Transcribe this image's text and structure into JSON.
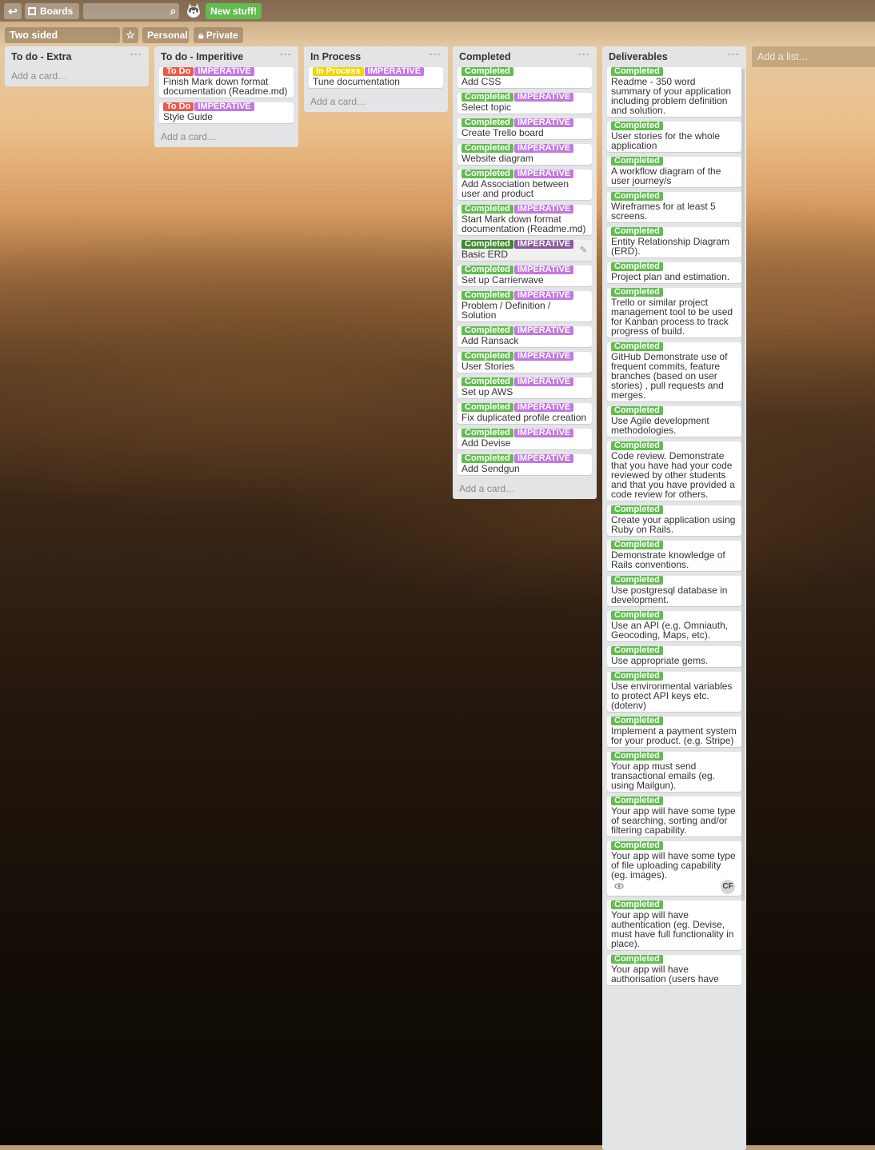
{
  "topbar": {
    "boards_label": "Boards",
    "search_value": "",
    "new_stuff_label": "New stuff!"
  },
  "board": {
    "title": "Two sided marketplace",
    "team_label": "Personal",
    "visibility_label": "Private"
  },
  "colors": {
    "green": "#61bd4f",
    "red": "#eb5a46",
    "purple": "#c377e0",
    "yellow": "#f2d600"
  },
  "add_card_label": "Add a card…",
  "add_list_label": "Add a list…",
  "lists": [
    {
      "name": "To do - Extra",
      "cards": []
    },
    {
      "name": "To do - Imperitive",
      "cards": [
        {
          "labels": [
            "To Do",
            "IMPERATIVE"
          ],
          "title": "Finish Mark down format documentation (Readme.md)"
        },
        {
          "labels": [
            "To Do",
            "IMPERATIVE"
          ],
          "title": "Style Guide"
        }
      ]
    },
    {
      "name": "In Process",
      "cards": [
        {
          "labels": [
            "In Process",
            "IMPERATIVE"
          ],
          "title": "Tune documentation"
        }
      ]
    },
    {
      "name": "Completed",
      "cards": [
        {
          "labels": [
            "Completed"
          ],
          "title": "Add CSS"
        },
        {
          "labels": [
            "Completed",
            "IMPERATIVE"
          ],
          "title": "Select topic"
        },
        {
          "labels": [
            "Completed",
            "IMPERATIVE"
          ],
          "title": "Create Trello board"
        },
        {
          "labels": [
            "Completed",
            "IMPERATIVE"
          ],
          "title": "Website diagram"
        },
        {
          "labels": [
            "Completed",
            "IMPERATIVE"
          ],
          "title": "Add Association between user and product"
        },
        {
          "labels": [
            "Completed",
            "IMPERATIVE"
          ],
          "title": "Start Mark down format documentation (Readme.md)"
        },
        {
          "labels": [
            "Completed",
            "IMPERATIVE"
          ],
          "title": "Basic ERD",
          "hover": true
        },
        {
          "labels": [
            "Completed",
            "IMPERATIVE"
          ],
          "title": "Set up Carrierwave"
        },
        {
          "labels": [
            "Completed",
            "IMPERATIVE"
          ],
          "title": "Problem / Definition / Solution"
        },
        {
          "labels": [
            "Completed",
            "IMPERATIVE"
          ],
          "title": "Add Ransack"
        },
        {
          "labels": [
            "Completed",
            "IMPERATIVE"
          ],
          "title": "User Stories"
        },
        {
          "labels": [
            "Completed",
            "IMPERATIVE"
          ],
          "title": "Set up AWS"
        },
        {
          "labels": [
            "Completed",
            "IMPERATIVE"
          ],
          "title": "Fix duplicated profile creation"
        },
        {
          "labels": [
            "Completed",
            "IMPERATIVE"
          ],
          "title": "Add Devise"
        },
        {
          "labels": [
            "Completed",
            "IMPERATIVE"
          ],
          "title": "Add Sendgun"
        }
      ]
    },
    {
      "name": "Deliverables",
      "cards": [
        {
          "labels": [
            "Completed"
          ],
          "title": "Readme - 350 word summary of your application including problem definition and solution."
        },
        {
          "labels": [
            "Completed"
          ],
          "title": "User stories for the whole application"
        },
        {
          "labels": [
            "Completed"
          ],
          "title": "A workflow diagram of the user journey/s"
        },
        {
          "labels": [
            "Completed"
          ],
          "title": "Wireframes for at least 5 screens."
        },
        {
          "labels": [
            "Completed"
          ],
          "title": "Entity Relationship Diagram (ERD)."
        },
        {
          "labels": [
            "Completed"
          ],
          "title": "Project plan and estimation."
        },
        {
          "labels": [
            "Completed"
          ],
          "title": "Trello or similar project management tool to be used for Kanban process to track progress of build."
        },
        {
          "labels": [
            "Completed"
          ],
          "title": "GitHub Demonstrate use of frequent commits, feature branches (based on user stories) , pull requests and merges."
        },
        {
          "labels": [
            "Completed"
          ],
          "title": "Use Agile development methodologies."
        },
        {
          "labels": [
            "Completed"
          ],
          "title": "Code review. Demonstrate that you have had your code reviewed by other students and that you have provided a code review for others."
        },
        {
          "labels": [
            "Completed"
          ],
          "title": "Create your application using Ruby on Rails."
        },
        {
          "labels": [
            "Completed"
          ],
          "title": "Demonstrate knowledge of Rails conventions."
        },
        {
          "labels": [
            "Completed"
          ],
          "title": "Use postgresql database in development."
        },
        {
          "labels": [
            "Completed"
          ],
          "title": "Use an API (e.g. Omniauth, Geocoding, Maps, etc)."
        },
        {
          "labels": [
            "Completed"
          ],
          "title": "Use appropriate gems."
        },
        {
          "labels": [
            "Completed"
          ],
          "title": "Use environmental variables to protect API keys etc. (dotenv)"
        },
        {
          "labels": [
            "Completed"
          ],
          "title": "Implement a payment system for your product. (e.g. Stripe)"
        },
        {
          "labels": [
            "Completed"
          ],
          "title": "Your app must send transactional emails (eg. using Mailgun)."
        },
        {
          "labels": [
            "Completed"
          ],
          "title": "Your app will have some type of searching, sorting and/or filtering capability."
        },
        {
          "labels": [
            "Completed"
          ],
          "title": "Your app will have some type of file uploading capability (eg. images).",
          "member": "CF",
          "watched": true
        },
        {
          "labels": [
            "Completed"
          ],
          "title": "Your app will have authentication (eg. Devise, must have full functionality in place)."
        },
        {
          "labels": [
            "Completed"
          ],
          "title": "Your app will have authorisation (users have"
        }
      ]
    }
  ]
}
